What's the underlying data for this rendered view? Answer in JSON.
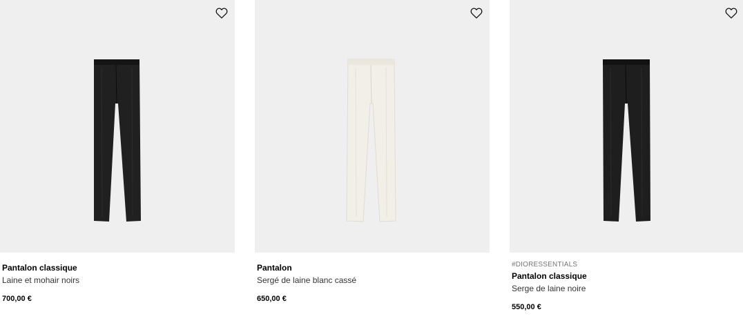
{
  "products": [
    {
      "name": "Pantalon classique",
      "description": "Laine et mohair noirs",
      "price": "700,00 €",
      "tag": "",
      "color": "#1f1f1f",
      "icon": "heart-icon"
    },
    {
      "name": "Pantalon",
      "description": "Sergé de laine blanc cassé",
      "price": "650,00 €",
      "tag": "",
      "color": "#f1eee7",
      "icon": "heart-icon"
    },
    {
      "name": "Pantalon classique",
      "description": "Serge de laine noire",
      "price": "550,00 €",
      "tag": "#DIORESSENTIALS",
      "color": "#1c1c1c",
      "icon": "heart-icon"
    }
  ],
  "colors": {
    "image_background": "#efeff0",
    "text": "#000000",
    "tag_text": "#757575"
  }
}
